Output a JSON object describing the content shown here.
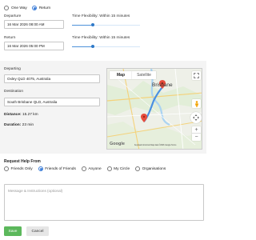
{
  "trip_type": {
    "one_way_label": "One Way",
    "return_label": "Return"
  },
  "departure": {
    "label": "Departure",
    "value": "16 Mar 2026 08:00 AM",
    "flex_label": "Time Flexibility: Within 15 minutes",
    "flex_level": 0.3
  },
  "return_trip": {
    "label": "Return",
    "value": "16 Mar 2026 05:00 PM",
    "flex_label": "Time Flexibility: Within 15 minutes",
    "flex_level": 0.3
  },
  "route": {
    "departing_label": "Departing",
    "departing_value": "Oxley QLD 4075, Australia",
    "destination_label": "Destination",
    "destination_value": "South Brisbane QLD, Australia",
    "distance_label": "Distance:",
    "distance_value": "15.27 km",
    "duration_label": "Duration:",
    "duration_value": "23 min"
  },
  "map": {
    "tab_map": "Map",
    "tab_satellite": "Satellite",
    "city_label": "Brisbane",
    "google_label": "Google",
    "attribution": "Keyboard shortcuts   Map data ©2026 Google   Terms"
  },
  "help": {
    "title": "Request Help From",
    "options": [
      "Friends Only",
      "Friends of Friends",
      "Anyone",
      "My Circle",
      "Organisations"
    ],
    "selected_index": 1
  },
  "message": {
    "placeholder": "Message & Instructions (optional)"
  },
  "actions": {
    "save_label": "Save",
    "cancel_label": "Cancel"
  },
  "colors": {
    "accent": "#3b7dd8",
    "save": "#5cb85c",
    "route": "#4a90e2",
    "marker": "#e84c3d"
  }
}
